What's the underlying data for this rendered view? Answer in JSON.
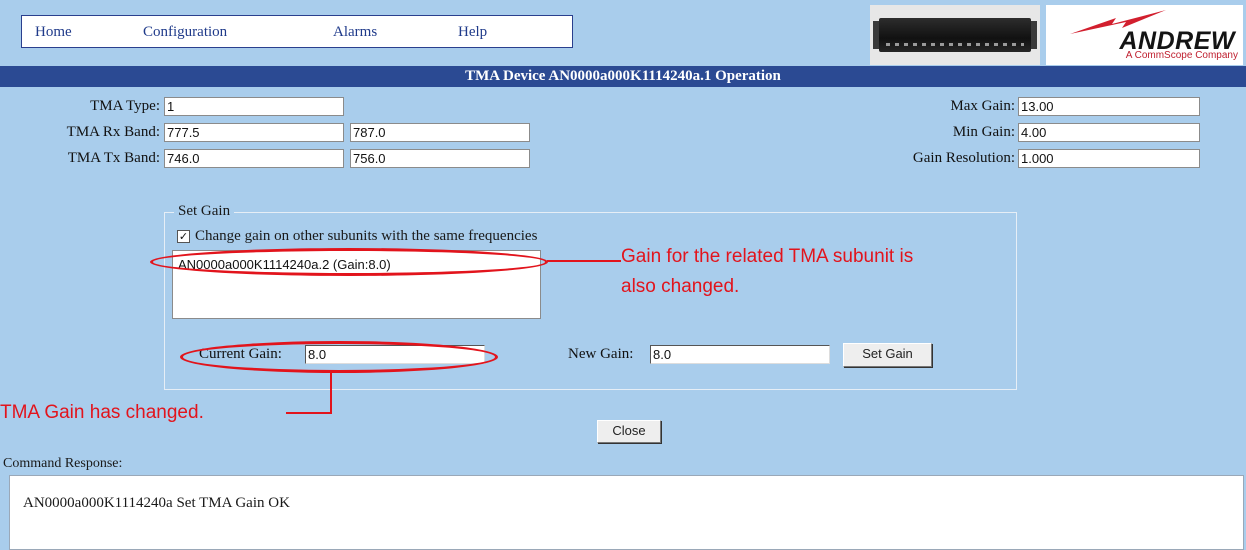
{
  "nav": {
    "items": [
      "Home",
      "Configuration",
      "Alarms",
      "Help"
    ]
  },
  "branding": {
    "logo_word": "ANDREW",
    "logo_sub": "A CommScope Company"
  },
  "title": "TMA Device AN0000a000K1114240a.1 Operation",
  "fields": {
    "tma_type_label": "TMA Type:",
    "tma_type": "1",
    "rx_band_label": "TMA Rx Band:",
    "rx_band_low": "777.5",
    "rx_band_high": "787.0",
    "tx_band_label": "TMA Tx Band:",
    "tx_band_low": "746.0",
    "tx_band_high": "756.0",
    "max_gain_label": "Max Gain:",
    "max_gain": "13.00",
    "min_gain_label": "Min Gain:",
    "min_gain": "4.00",
    "gain_res_label": "Gain Resolution:",
    "gain_res": "1.000"
  },
  "set_gain": {
    "legend": "Set Gain",
    "checkbox_label": "Change gain on other subunits with the same frequencies",
    "checkbox_checked": true,
    "checkbox_mark": "✓",
    "subunits": [
      "AN0000a000K1114240a.2 (Gain:8.0)"
    ],
    "current_gain_label": "Current Gain:",
    "current_gain": "8.0",
    "new_gain_label": "New Gain:",
    "new_gain": "8.0",
    "set_gain_button": "Set Gain"
  },
  "close_button": "Close",
  "command": {
    "label": "Command Response:",
    "response": "AN0000a000K1114240a Set TMA Gain OK"
  },
  "annotations": {
    "subunit_note_line1": "Gain for the related TMA subunit is",
    "subunit_note_line2": "also changed.",
    "gain_note": "TMA Gain has changed."
  },
  "colors": {
    "background": "#a9cdec",
    "title_bar": "#2b4a93",
    "annotation": "#e2141c"
  }
}
